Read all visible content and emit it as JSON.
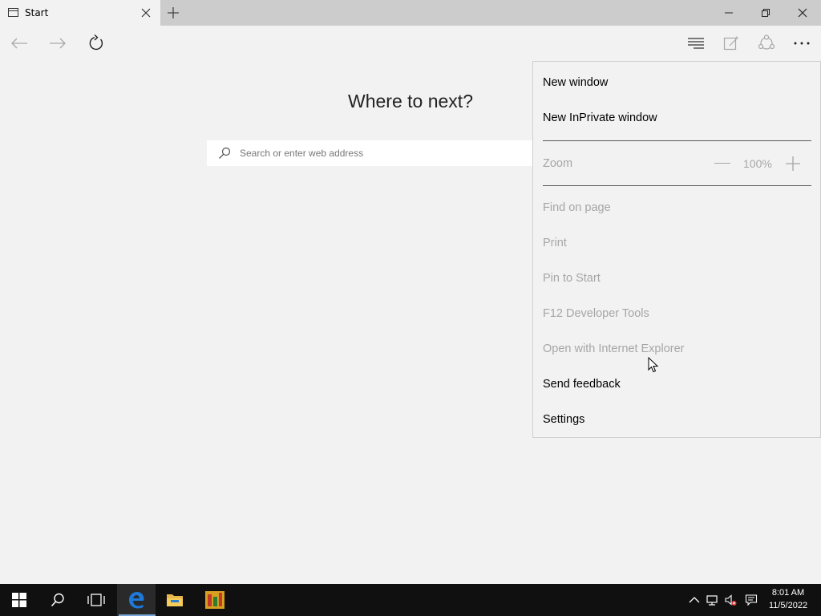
{
  "browser": {
    "tab_title": "Start",
    "heading": "Where to next?",
    "search_placeholder": "Search or enter web address"
  },
  "menu": {
    "items": [
      {
        "label": "New window",
        "enabled": true
      },
      {
        "label": "New InPrivate window",
        "enabled": true
      },
      {
        "label": "Zoom",
        "enabled": false
      },
      {
        "label": "Find on page",
        "enabled": false
      },
      {
        "label": "Print",
        "enabled": false
      },
      {
        "label": "Pin to Start",
        "enabled": false
      },
      {
        "label": "F12 Developer Tools",
        "enabled": false
      },
      {
        "label": "Open with Internet Explorer",
        "enabled": false
      },
      {
        "label": "Send feedback",
        "enabled": true
      },
      {
        "label": "Settings",
        "enabled": true
      }
    ],
    "zoom_value": "100%"
  },
  "taskbar": {
    "time": "8:01 AM",
    "date": "11/5/2022"
  },
  "colors": {
    "background": "#f2f2f2",
    "titlebar": "#cccccc",
    "taskbar": "#101010",
    "edge_blue": "#1e78d7",
    "disabled_text": "#a6a6a6"
  },
  "icons": [
    "page-icon",
    "close-icon",
    "plus-icon",
    "minimize-icon",
    "restore-icon",
    "back-arrow-icon",
    "forward-arrow-icon",
    "refresh-icon",
    "hub-icon",
    "web-note-icon",
    "share-icon",
    "more-icon",
    "search-icon",
    "windows-logo-icon",
    "cortana-search-icon",
    "task-view-icon",
    "edge-icon",
    "file-explorer-icon",
    "app-icon",
    "chevron-up-icon",
    "network-icon",
    "volume-muted-icon",
    "notification-icon"
  ]
}
